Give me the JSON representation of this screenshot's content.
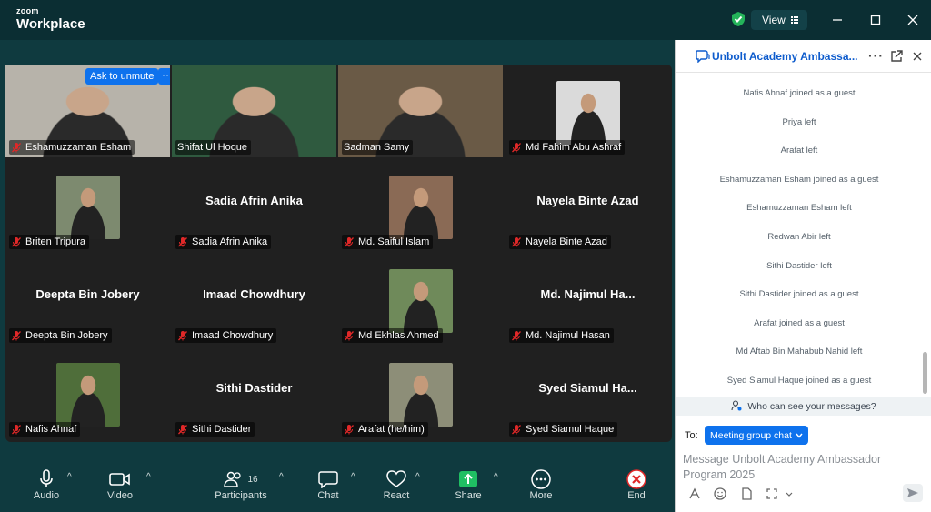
{
  "app": {
    "brand_top": "zoom",
    "brand_bottom": "Workplace",
    "view_label": "View"
  },
  "grid": {
    "ask_to_unmute": "Ask to unmute",
    "more_label": "···",
    "tiles": [
      {
        "name": "Eshamuzzaman Esham",
        "muted": true,
        "kind": "video",
        "bg": "#b7b3aa"
      },
      {
        "name": "Shifat Ul Hoque",
        "muted": false,
        "kind": "video",
        "bg": "#2f5a3f"
      },
      {
        "name": "Sadman Samy",
        "muted": false,
        "kind": "video",
        "bg": "#6a5a46",
        "active": true
      },
      {
        "name": "Md Fahim Abu Ashraf",
        "muted": true,
        "kind": "photo",
        "bg": "#dadada"
      },
      {
        "name": "Briten Tripura",
        "muted": true,
        "kind": "photo",
        "bg": "#7d8a6f"
      },
      {
        "name": "Sadia Afrin Anika",
        "muted": true,
        "kind": "name",
        "big": "Sadia Afrin Anika"
      },
      {
        "name": "Md. Saiful Islam",
        "muted": true,
        "kind": "photo",
        "bg": "#8a6a55"
      },
      {
        "name": "Nayela Binte Azad",
        "muted": true,
        "kind": "name",
        "big": "Nayela Binte Azad"
      },
      {
        "name": "Deepta Bin Jobery",
        "muted": true,
        "kind": "name",
        "big": "Deepta Bin Jobery"
      },
      {
        "name": "Imaad Chowdhury",
        "muted": true,
        "kind": "name",
        "big": "Imaad Chowdhury"
      },
      {
        "name": "Md Ekhlas Ahmed",
        "muted": true,
        "kind": "photo",
        "bg": "#6f8a5a"
      },
      {
        "name": "Md. Najimul Hasan",
        "muted": true,
        "kind": "name",
        "big": "Md.  Najimul  Ha..."
      },
      {
        "name": "Nafis Ahnaf",
        "muted": true,
        "kind": "photo",
        "bg": "#4f6e3a"
      },
      {
        "name": "Sithi Dastider",
        "muted": true,
        "kind": "name",
        "big": "Sithi Dastider"
      },
      {
        "name": "Arafat (he/him)",
        "muted": true,
        "kind": "photo",
        "bg": "#8d8e78"
      },
      {
        "name": "Syed Siamul Haque",
        "muted": true,
        "kind": "name",
        "big": "Syed  Siamul  Ha..."
      }
    ]
  },
  "toolbar": {
    "audio": "Audio",
    "video": "Video",
    "participants": "Participants",
    "participants_count": "16",
    "chat": "Chat",
    "react": "React",
    "share": "Share",
    "more": "More",
    "end": "End"
  },
  "chat": {
    "title": "Unbolt Academy Ambassa...",
    "messages": [
      "Nafis Ahnaf joined as a guest",
      "Priya left",
      "Arafat left",
      "Eshamuzzaman Esham joined as a guest",
      "Eshamuzzaman Esham left",
      "Redwan Abir left",
      "Sithi Dastider left",
      "Sithi Dastider joined as a guest",
      "Arafat joined as a guest",
      "Md Aftab Bin Mahabub Nahid left",
      "Syed Siamul Haque joined as a guest"
    ],
    "privacy": "Who can see your messages?",
    "to_label": "To:",
    "to_value": "Meeting group chat",
    "placeholder": "Message Unbolt Academy Ambassador Program 2025"
  },
  "colors": {
    "accent": "#0e72ed",
    "active_border": "#37c874",
    "mute": "#e02828",
    "share": "#1fbf63",
    "end": "#e02828"
  }
}
